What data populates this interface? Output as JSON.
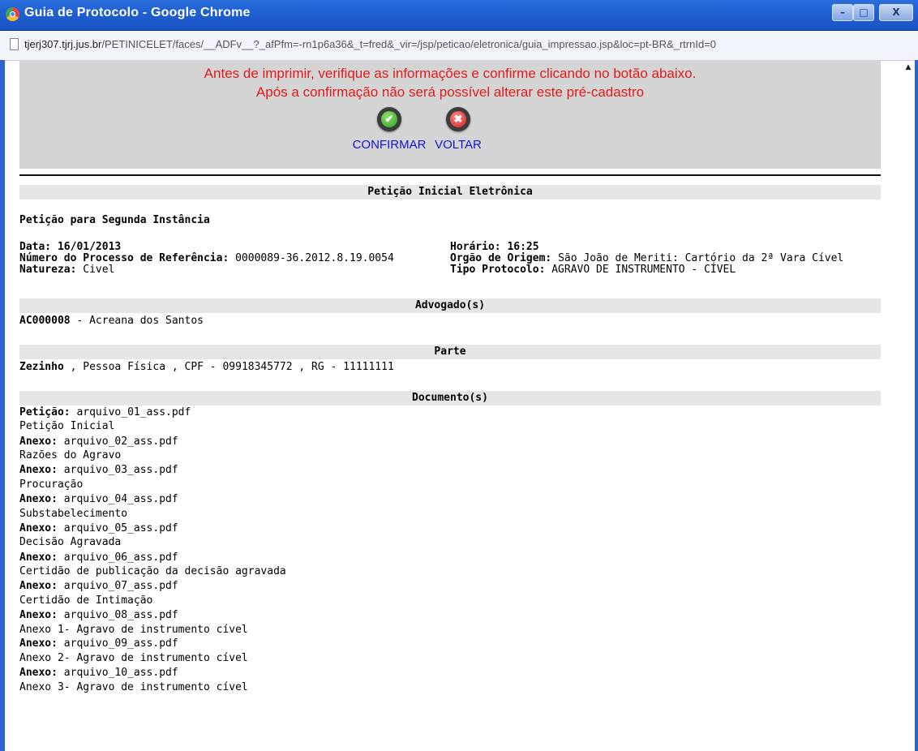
{
  "window": {
    "title": "Guia de Protocolo - Google Chrome",
    "url_host": "tjerj307.tjrj.jus.br",
    "url_path": "/PETINICELET/faces/__ADFv__?_afPfm=-rn1p6a36&_t=fred&_vir=/jsp/peticao/eletronica/guia_impressao.jsp&loc=pt-BR&_rtrnId=0",
    "min_label": "–",
    "max_label": "□",
    "close_label": "X"
  },
  "confirm": {
    "warning_line1": "Antes de imprimir, verifique as informações e confirme clicando no botão abaixo.",
    "warning_line2": "Após a confirmação não será possível alterar este pré-cadastro",
    "confirm_label": "CONFIRMAR",
    "back_label": "VOLTAR"
  },
  "header": {
    "section_title": "Petição Inicial Eletrônica",
    "subtitle": "Petição para Segunda Instância"
  },
  "details": {
    "data_label": "Data:",
    "data_value": "16/01/2013",
    "horario_label": "Horário:",
    "horario_value": "16:25",
    "processo_label": "Número do Processo de Referência:",
    "processo_value": "0000089-36.2012.8.19.0054",
    "origem_label": "Orgão de Origem:",
    "origem_value": "São João de Meriti: Cartório da 2ª Vara Cível",
    "natureza_label": "Natureza:",
    "natureza_value": "Civel",
    "tipo_label": "Tipo Protocolo:",
    "tipo_value": "AGRAVO DE INSTRUMENTO - CÍVEL"
  },
  "advogados": {
    "title": "Advogado(s)",
    "code": "AC000008",
    "name": "- Acreana dos Santos"
  },
  "parte": {
    "title": "Parte",
    "name": "Zezinho",
    "details": ", Pessoa Física , CPF - 09918345772 , RG - 11111111"
  },
  "documentos": {
    "title": "Documento(s)",
    "items": [
      {
        "label": "Petição:",
        "file": "arquivo_01_ass.pdf",
        "desc": "Petição Inicial"
      },
      {
        "label": "Anexo:",
        "file": "arquivo_02_ass.pdf",
        "desc": "Razões do Agravo"
      },
      {
        "label": "Anexo:",
        "file": "arquivo_03_ass.pdf",
        "desc": "Procuração"
      },
      {
        "label": "Anexo:",
        "file": "arquivo_04_ass.pdf",
        "desc": "Substabelecimento"
      },
      {
        "label": "Anexo:",
        "file": "arquivo_05_ass.pdf",
        "desc": "Decisão Agravada"
      },
      {
        "label": "Anexo:",
        "file": "arquivo_06_ass.pdf",
        "desc": "Certidão de publicação da decisão agravada"
      },
      {
        "label": "Anexo:",
        "file": "arquivo_07_ass.pdf",
        "desc": "Certidão de Intimação"
      },
      {
        "label": "Anexo:",
        "file": "arquivo_08_ass.pdf",
        "desc": "Anexo 1- Agravo de instrumento cível"
      },
      {
        "label": "Anexo:",
        "file": "arquivo_09_ass.pdf",
        "desc": "Anexo 2- Agravo de instrumento cível"
      },
      {
        "label": "Anexo:",
        "file": "arquivo_10_ass.pdf",
        "desc": "Anexo 3- Agravo de instrumento cível"
      }
    ]
  }
}
